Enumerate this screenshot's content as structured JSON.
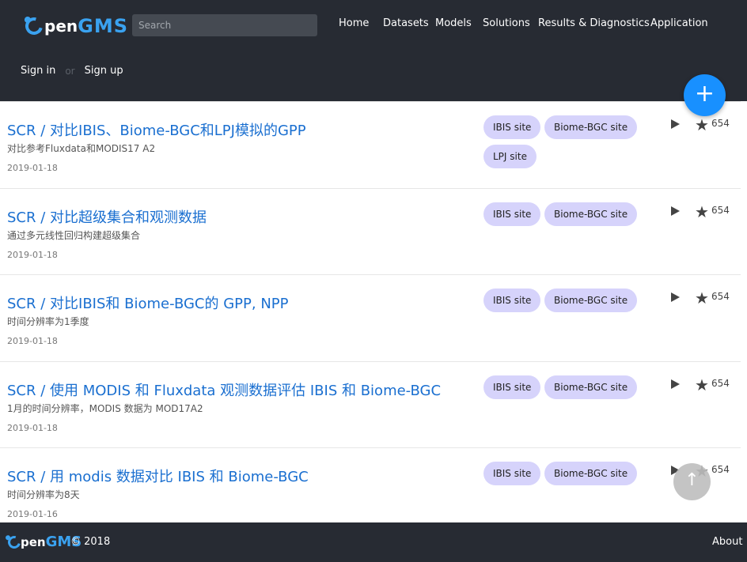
{
  "header": {
    "logo_o": "O",
    "logo_pen": "pen",
    "logo_gms": "GMS",
    "search_placeholder": "Search",
    "nav": [
      "Home",
      "Datasets",
      "Models",
      "Solutions",
      "Results & Diagnostics",
      "Application"
    ],
    "sign_in": "Sign in",
    "or": "or",
    "sign_up": "Sign up"
  },
  "fab_label": "+",
  "items": [
    {
      "title": "SCR / 对比IBIS、Biome-BGC和LPJ模拟的GPP",
      "desc": "对比参考Fluxdata和MODIS17 A2",
      "date": "2019-01-18",
      "tags": [
        "IBIS site",
        "Biome-BGC site",
        "LPJ site"
      ],
      "stars": "654"
    },
    {
      "title": "SCR / 对比超级集合和观测数据",
      "desc": "通过多元线性回归构建超级集合",
      "date": "2019-01-18",
      "tags": [
        "IBIS site",
        "Biome-BGC site"
      ],
      "stars": "654"
    },
    {
      "title": "SCR / 对比IBIS和 Biome-BGC的 GPP, NPP",
      "desc": "时间分辨率为1季度",
      "date": "2019-01-18",
      "tags": [
        "IBIS site",
        "Biome-BGC site"
      ],
      "stars": "654"
    },
    {
      "title": "SCR / 使用 MODIS 和 Fluxdata 观测数据评估 IBIS 和 Biome-BGC",
      "desc": "1月的时间分辨率，MODIS 数据为 MOD17A2",
      "date": "2019-01-18",
      "tags": [
        "IBIS site",
        "Biome-BGC site"
      ],
      "stars": "654"
    },
    {
      "title": "SCR / 用 modis 数据对比 IBIS 和 Biome-BGC",
      "desc": "时间分辨率为8天",
      "date": "2019-01-16",
      "tags": [
        "IBIS site",
        "Biome-BGC site"
      ],
      "stars": "654"
    }
  ],
  "footer": {
    "copyright": "© 2018",
    "about": "About"
  },
  "colors": {
    "header_bg": "#272b33",
    "brand_blue": "#3aa2f0",
    "title_blue": "#1a6fd0",
    "tag_bg": "#d6d3fb",
    "fab": "#1890ff"
  }
}
